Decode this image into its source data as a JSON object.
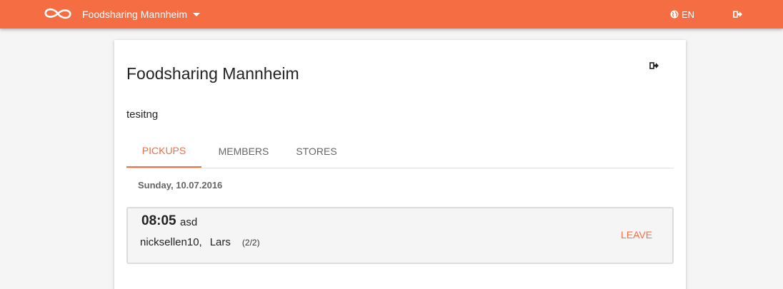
{
  "colors": {
    "accent": "#f46d43",
    "background": "#f5f5f5",
    "card": "#ffffff"
  },
  "topbar": {
    "logo_icon": "infinity-logo-icon",
    "group_name": "Foodsharing Mannheim",
    "language": "EN",
    "language_icon": "globe-icon",
    "logout_icon": "logout-icon"
  },
  "group": {
    "title": "Foodsharing Mannheim",
    "description": "tesitng",
    "leave_icon": "logout-icon"
  },
  "tabs": [
    {
      "label": "PICKUPS",
      "active": true
    },
    {
      "label": "MEMBERS",
      "active": false
    },
    {
      "label": "STORES",
      "active": false
    }
  ],
  "pickups": {
    "date": "Sunday, 10.07.2016",
    "items": [
      {
        "time": "08:05",
        "description": "asd",
        "members": [
          "nicksellen10,",
          "Lars"
        ],
        "slots": "(2/2)",
        "action": "LEAVE"
      }
    ]
  }
}
